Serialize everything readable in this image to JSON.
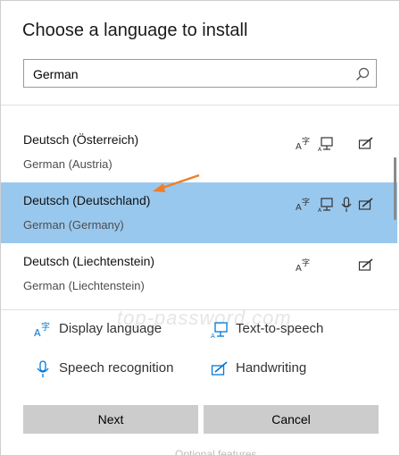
{
  "dialog": {
    "title": "Choose a language to install",
    "search": {
      "value": "German",
      "icon": "search-icon"
    },
    "list": {
      "peek_text": "",
      "rows": [
        {
          "name": "Deutsch (Österreich)",
          "sub": "German (Austria)",
          "selected": false,
          "features": [
            "display-language",
            "text-to-speech",
            "handwriting"
          ]
        },
        {
          "name": "Deutsch (Deutschland)",
          "sub": "German (Germany)",
          "selected": true,
          "features": [
            "display-language",
            "text-to-speech",
            "speech-recognition",
            "handwriting"
          ]
        },
        {
          "name": "Deutsch (Liechtenstein)",
          "sub": "German (Liechtenstein)",
          "selected": false,
          "features": [
            "display-language",
            "handwriting"
          ]
        }
      ]
    },
    "legend": {
      "display_language": "Display language",
      "text_to_speech": "Text-to-speech",
      "speech_recognition": "Speech recognition",
      "handwriting": "Handwriting"
    },
    "watermark": "top-password.com",
    "buttons": {
      "next": "Next",
      "cancel": "Cancel"
    },
    "bottom_text": "Optional features"
  },
  "colors": {
    "selected_row": "#99c8ee",
    "accent_icon": "#0078d7",
    "arrow": "#f07d28",
    "button": "#cccccc"
  }
}
